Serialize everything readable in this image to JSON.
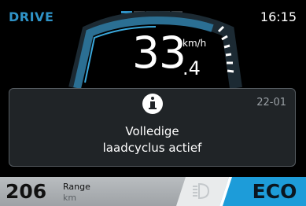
{
  "status": {
    "mode": "DRIVE",
    "time": "16:15",
    "page_count": 5,
    "active_page": 1
  },
  "speed": {
    "integer": "33",
    "decimal": ".4",
    "unit": "km/h"
  },
  "message": {
    "icon": "info-icon",
    "code": "22-01",
    "line1": "Volledige",
    "line2": "laadcyclus actief"
  },
  "range": {
    "value": "206",
    "label": "Range",
    "unit": "km"
  },
  "lights": {
    "icon": "headlight-icon"
  },
  "assist": {
    "mode": "ECO"
  },
  "colors": {
    "accent": "#2f93c7",
    "eco": "#1d9cd9",
    "dialog_bg": "#202427"
  }
}
